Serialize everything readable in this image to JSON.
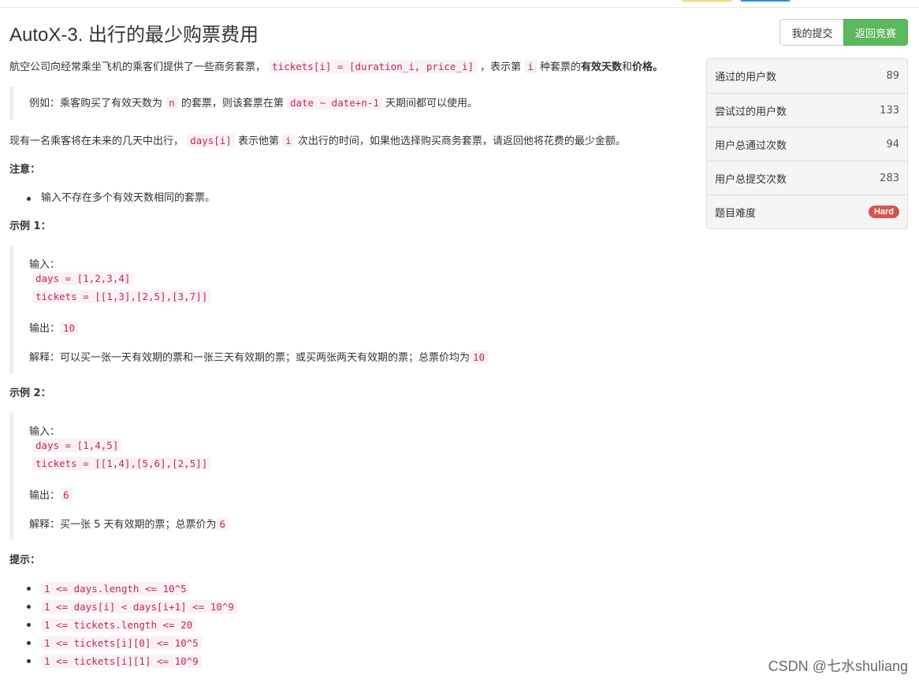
{
  "problem": {
    "title": "AutoX-3. 出行的最少购票费用",
    "intro_a": "航空公司向经常乘坐飞机的乘客们提供了一些商务套票，",
    "intro_code": "tickets[i] = [duration_i, price_i]",
    "intro_b": "，表示第",
    "intro_i": "i",
    "intro_c": "种套票的",
    "intro_bold1": "有效天数",
    "intro_d": "和",
    "intro_bold2": "价格",
    "intro_e": "。",
    "quote_a": "例如：乘客购买了有效天数为",
    "quote_n": "n",
    "quote_b": "的套票，则该套票在第",
    "quote_code": "date ~ date+n-1",
    "quote_c": "天期间都可以使用。",
    "para2_a": "现有一名乘客将在未来的几天中出行，",
    "para2_code": "days[i]",
    "para2_b": "表示他第",
    "para2_i": "i",
    "para2_c": "次出行的时间，如果他选择购买商务套票，请返回他将花费的最少金额。",
    "note_title": "注意：",
    "note_item": "输入不存在多个有效天数相同的套票。",
    "example1": {
      "title": "示例 1：",
      "input_label": "输入：",
      "days": "days = [1,2,3,4]",
      "tickets": "tickets = [[1,3],[2,5],[3,7]]",
      "output_label": "输出：",
      "output": "10",
      "explain_label": "解释：可以买一张一天有效期的票和一张三天有效期的票；或买两张两天有效期的票；总票价均为",
      "explain_val": "10"
    },
    "example2": {
      "title": "示例 2：",
      "input_label": "输入：",
      "days": "days = [1,4,5]",
      "tickets": "tickets = [[1,4],[5,6],[2,5]]",
      "output_label": "输出：",
      "output": "6",
      "explain_label": "解释：买一张 5 天有效期的票；总票价为",
      "explain_val": "6"
    },
    "hints_title": "提示：",
    "hints": [
      "1 <= days.length <= 10^5",
      "1 <= days[i] < days[i+1] <= 10^9",
      "1 <= tickets.length <= 20",
      "1 <= tickets[i][0] <= 10^5",
      "1 <= tickets[i][1] <= 10^9"
    ]
  },
  "buttons": {
    "my_submissions": "我的提交",
    "back_to_contest": "返回竞赛"
  },
  "stats": [
    {
      "label": "通过的用户数",
      "value": "89"
    },
    {
      "label": "尝试过的用户数",
      "value": "133"
    },
    {
      "label": "用户总通过次数",
      "value": "94"
    },
    {
      "label": "用户总提交次数",
      "value": "283"
    },
    {
      "label": "题目难度",
      "value": "Hard"
    }
  ],
  "watermark": "CSDN @七水shuliang",
  "colors": {
    "accent_green": "#5cb85c",
    "hard_red": "#d9534f",
    "code_red": "#c7254e"
  }
}
